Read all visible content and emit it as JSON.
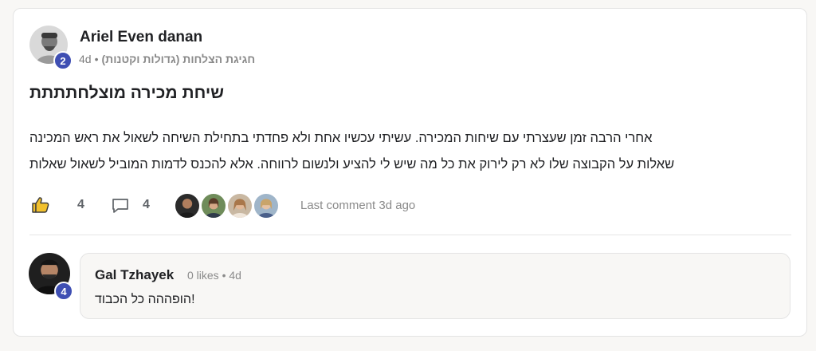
{
  "post": {
    "author": {
      "name": "Ariel Even danan",
      "level": "2"
    },
    "time": "4d",
    "separator": "•",
    "category": "חגיגת הצלחות (גדולות וקטנות)",
    "title": "שיחת מכירה מוצלחתתתת",
    "body_lines": [
      "אחרי הרבה זמן שעצרתי עם שיחות המכירה. עשיתי עכשיו אחת ולא פחדתי בתחילת השיחה לשאול את ראש המכינה",
      "שאלות על הקבוצה שלו לא רק לירוק את כל מה שיש לי להציע ולנשום לרווחה. אלא להכנס לדמות המוביל לשאול שאלות"
    ],
    "likes": "4",
    "comments": "4",
    "last_comment": "Last comment 3d ago"
  },
  "comment": {
    "author": "Gal Tzhayek",
    "level": "4",
    "meta": "0 likes • 4d",
    "text": "הופההה כל הכבוד!"
  },
  "colors": {
    "accent_badge": "#3f4fb3",
    "like_icon": "#f2c12e",
    "card_bg": "#ffffff",
    "page_bg": "#f8f7f5"
  }
}
